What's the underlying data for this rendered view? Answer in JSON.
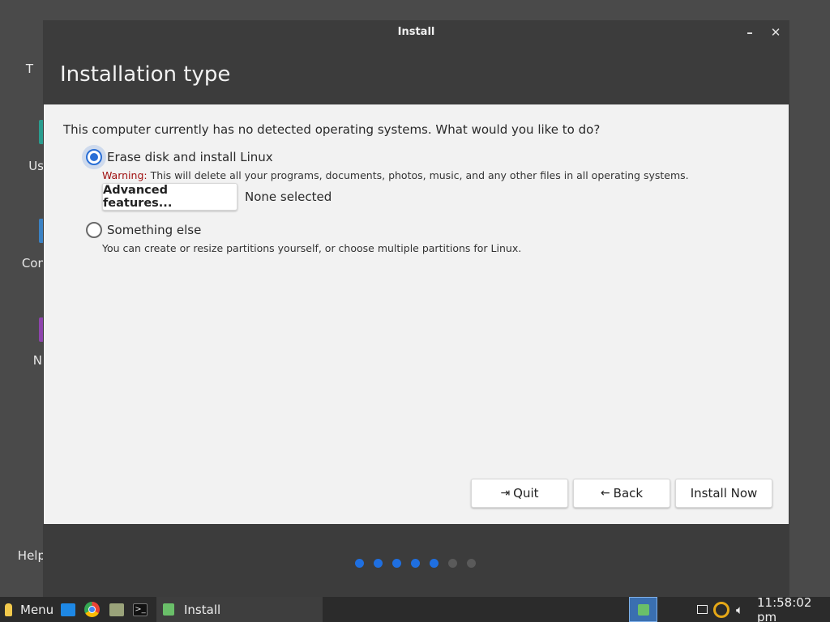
{
  "desktop": {
    "items": [
      "T",
      "Us",
      "Con",
      "N",
      "Help"
    ]
  },
  "window": {
    "title": "Install",
    "minimize": "–",
    "close": "✕"
  },
  "page": {
    "title": "Installation type",
    "question": "This computer currently has no detected operating systems. What would you like to do?"
  },
  "options": {
    "erase": {
      "label": "Erase disk and install Linux",
      "warning_prefix": "Warning:",
      "warning_text": " This will delete all your programs, documents, photos, music, and any other files in all operating systems.",
      "selected": true
    },
    "advanced_button": "Advanced features...",
    "advanced_status": "None selected",
    "something_else": {
      "label": "Something else",
      "description": "You can create or resize partitions yourself, or choose multiple partitions for Linux.",
      "selected": false
    }
  },
  "buttons": {
    "quit": "Quit",
    "back": "Back",
    "install": "Install Now"
  },
  "progress": {
    "total": 7,
    "completed": 5,
    "active_color": "#1f6fe0",
    "inactive_color": "#5a5a5a"
  },
  "taskbar": {
    "menu": "Menu",
    "task": "Install",
    "clock": "11:58:02 pm"
  },
  "colors": {
    "accent": "#2a6fd6",
    "warning": "#a01010"
  }
}
